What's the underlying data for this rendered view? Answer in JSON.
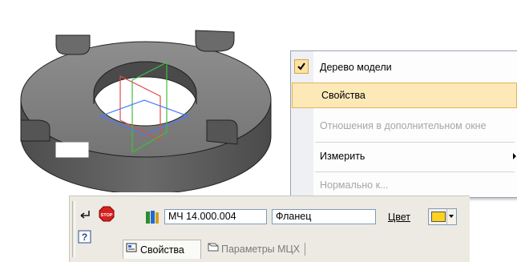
{
  "viewport": {
    "part_name": "flange-washer-3d-model",
    "colors": {
      "body_top": "#7c7c7c",
      "body_side": "#5f5f5f",
      "axis_red": "#e24b4b",
      "axis_green": "#3fbf3f",
      "axis_blue": "#4a78ff"
    }
  },
  "context_menu": {
    "items": [
      {
        "label": "Дерево модели",
        "checked": true,
        "state": "normal"
      },
      {
        "label": "Свойства",
        "checked": false,
        "state": "selected"
      },
      {
        "label": "Отношения в дополнительном окне",
        "checked": false,
        "state": "disabled"
      },
      {
        "label": "Измерить",
        "checked": false,
        "state": "normal",
        "submenu": true
      },
      {
        "label": "Нормально к...",
        "checked": false,
        "state": "disabled"
      }
    ]
  },
  "property_bar": {
    "designation": "МЧ 14.000.004",
    "name": "Фланец",
    "color_label": "Цвет",
    "color_value": "#ffd21f",
    "buttons": {
      "enter": "enter-icon",
      "stop": "stop-icon",
      "help": "help-icon",
      "library": "library-icon"
    },
    "tabs": [
      {
        "label": "Свойства",
        "active": true
      },
      {
        "label": "Параметры МЦХ",
        "active": false
      }
    ]
  }
}
